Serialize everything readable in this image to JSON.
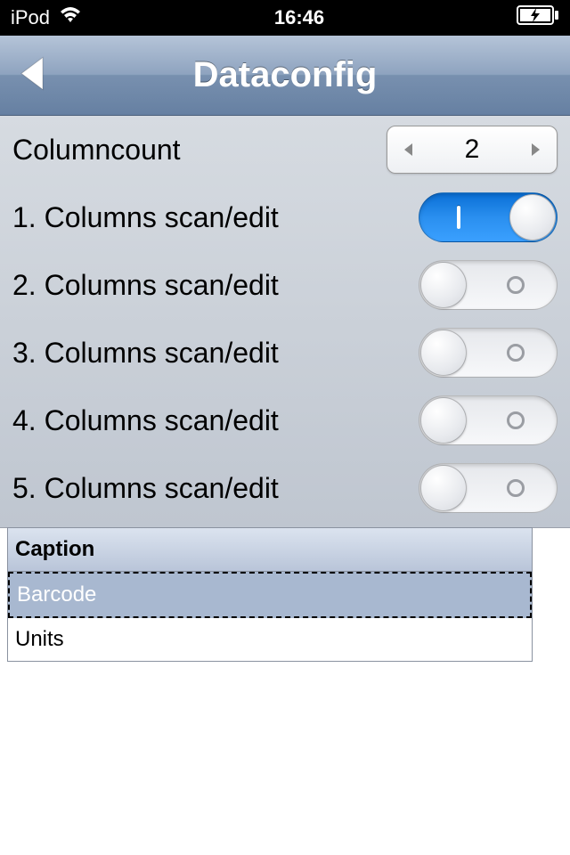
{
  "status": {
    "device": "iPod",
    "time": "16:46"
  },
  "nav": {
    "title": "Dataconfig"
  },
  "columncount": {
    "label": "Columncount",
    "value": "2"
  },
  "rows": [
    {
      "label": "1. Columns scan/edit",
      "on": true
    },
    {
      "label": "2. Columns scan/edit",
      "on": false
    },
    {
      "label": "3. Columns scan/edit",
      "on": false
    },
    {
      "label": "4. Columns scan/edit",
      "on": false
    },
    {
      "label": "5. Columns scan/edit",
      "on": false
    }
  ],
  "table": {
    "header": "Caption",
    "rows": [
      {
        "label": "Barcode",
        "selected": true
      },
      {
        "label": "Units",
        "selected": false
      }
    ]
  }
}
